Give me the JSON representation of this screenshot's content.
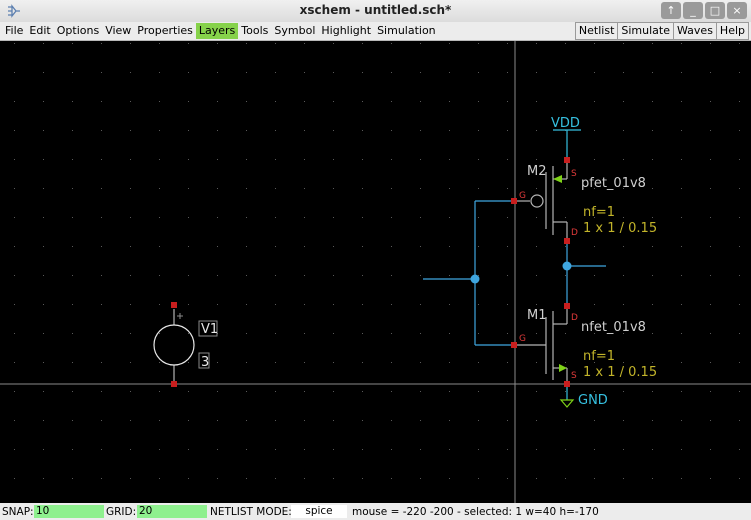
{
  "window": {
    "title": "xschem - untitled.sch*",
    "controls": [
      "↑",
      "_",
      "□",
      "×"
    ]
  },
  "menubar": {
    "items": [
      "File",
      "Edit",
      "Options",
      "View",
      "Properties",
      "Layers",
      "Tools",
      "Symbol",
      "Highlight",
      "Simulation"
    ],
    "active_item": "Layers",
    "right_buttons": [
      "Netlist",
      "Simulate",
      "Waves",
      "Help"
    ]
  },
  "schematic": {
    "colors": {
      "background": "#000000",
      "wire": "#3fa6e0",
      "symbol": "#b5b5b5",
      "pin": "#c81e1e",
      "pin_label": "#e03a3a",
      "net_label": "#36c0e0",
      "attribute": "#c2b42a",
      "arrow": "#7fd318",
      "selection": "#e8e8e8"
    },
    "components": [
      {
        "ref": "M2",
        "model": "pfet_01v8",
        "nf": "nf=1",
        "size": "1 x 1 / 0.15",
        "pins": [
          "G",
          "S",
          "D"
        ]
      },
      {
        "ref": "M1",
        "model": "nfet_01v8",
        "nf": "nf=1",
        "size": "1 x 1 / 0.15",
        "pins": [
          "G",
          "D",
          "S"
        ]
      },
      {
        "ref": "V1",
        "value": "3"
      }
    ],
    "net_labels": {
      "vdd": "VDD",
      "gnd": "GND"
    }
  },
  "statusbar": {
    "snap_label": "SNAP:",
    "snap_value": "10",
    "grid_label": "GRID:",
    "grid_value": "20",
    "netlist_label": "NETLIST MODE:",
    "netlist_value": "spice",
    "info": "mouse = -220 -200 - selected: 1 w=40 h=-170"
  }
}
